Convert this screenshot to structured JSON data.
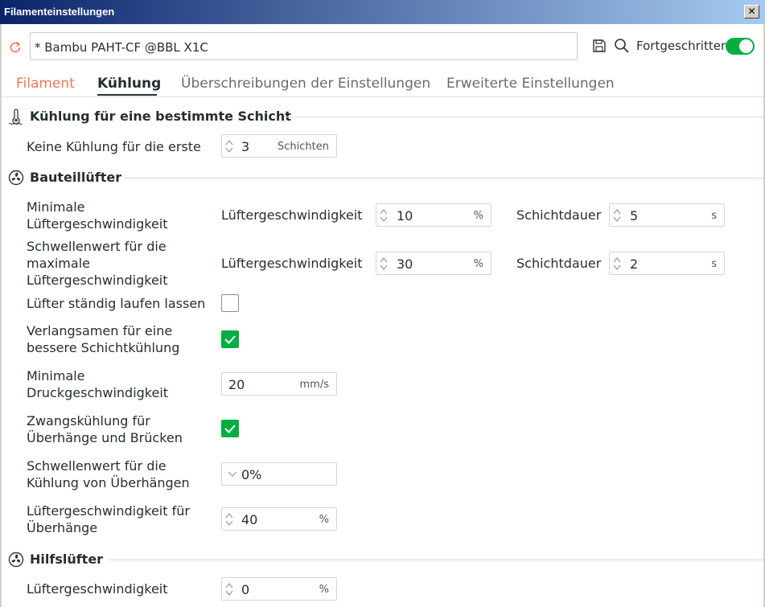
{
  "window": {
    "title": "Filamenteinstellungen",
    "close": "✕"
  },
  "toolbar": {
    "preset_name": "* Bambu PAHT-CF @BBL X1C",
    "advanced_label": "Fortgeschritten",
    "advanced_on": true
  },
  "tabs": [
    {
      "label": "Filament"
    },
    {
      "label": "Kühlung"
    },
    {
      "label": "Überschreibungen der Einstellungen"
    },
    {
      "label": "Erweiterte Einstellungen"
    }
  ],
  "sections": {
    "layer_cooling": {
      "title": "Kühlung für eine bestimmte Schicht",
      "no_cooling_label": "Keine Kühlung für die erste",
      "no_cooling_value": "3",
      "no_cooling_unit": "Schichten"
    },
    "part_fan": {
      "title": "Bauteillüfter",
      "min_fan": {
        "label": "Minimale Lüftergeschwindigkeit",
        "speed_label": "Lüftergeschwindigkeit",
        "speed_value": "10",
        "speed_unit": "%",
        "time_label": "Schichtdauer",
        "time_value": "5",
        "time_unit": "s"
      },
      "max_fan": {
        "label": "Schwellenwert für die maximale Lüftergeschwindigkeit",
        "speed_label": "Lüftergeschwindigkeit",
        "speed_value": "30",
        "speed_unit": "%",
        "time_label": "Schichtdauer",
        "time_value": "2",
        "time_unit": "s"
      },
      "always_on": {
        "label": "Lüfter ständig laufen lassen",
        "checked": false
      },
      "slow_down": {
        "label": "Verlangsamen für eine bessere Schichtkühlung",
        "checked": true
      },
      "min_speed": {
        "label": "Minimale Druckgeschwindigkeit",
        "value": "20",
        "unit": "mm/s"
      },
      "overhang_cooling": {
        "label": "Zwangskühlung für Überhänge und Brücken",
        "checked": true
      },
      "overhang_threshold": {
        "label": "Schwellenwert für die Kühlung von Überhängen",
        "value": "0%"
      },
      "overhang_fan": {
        "label": "Lüftergeschwindigkeit für Überhänge",
        "value": "40",
        "unit": "%"
      }
    },
    "aux_fan": {
      "title": "Hilfslüfter",
      "fan": {
        "label": "Lüftergeschwindigkeit",
        "value": "0",
        "unit": "%"
      }
    }
  },
  "colors": {
    "accent": "#00ae42",
    "tab_orange": "#f07856",
    "text": "#262e30"
  }
}
